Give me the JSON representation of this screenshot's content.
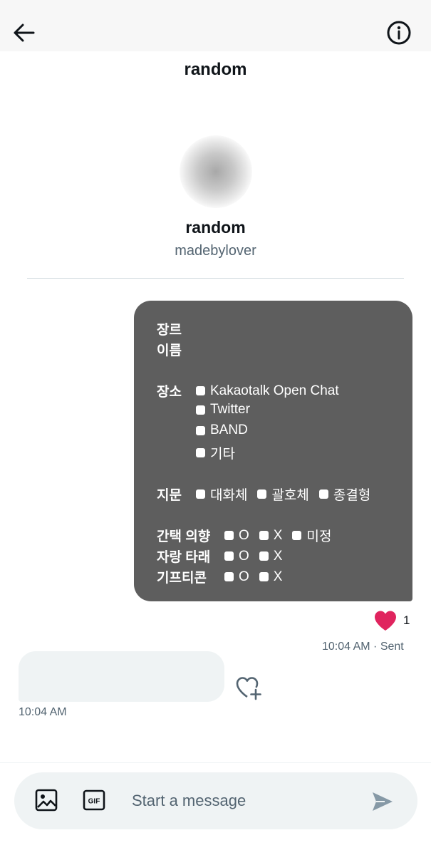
{
  "header": {
    "title": "random",
    "back_icon": "arrow-left-icon",
    "info_icon": "info-icon"
  },
  "profile": {
    "name": "random",
    "handle": "madebylover"
  },
  "outgoing_message": {
    "genre_label": "장르",
    "name_label": "이름",
    "place": {
      "label": "장소",
      "options": [
        "Kakaotalk Open Chat",
        "Twitter",
        "BAND",
        "기타"
      ]
    },
    "narration": {
      "label": "지문",
      "options": [
        "대화체",
        "괄호체",
        "종결형"
      ]
    },
    "interest": {
      "label": "간택 의향",
      "options": [
        "O",
        "X",
        "미정"
      ]
    },
    "self_promo": {
      "label": "자랑 타래",
      "options": [
        "O",
        "X"
      ]
    },
    "gifticon": {
      "label": "기프티콘",
      "options": [
        "O",
        "X"
      ]
    },
    "reaction_count": "1",
    "meta": "10:04 AM · Sent"
  },
  "incoming_message": {
    "meta": "10:04 AM"
  },
  "composer": {
    "placeholder": "Start a message",
    "gif_label": "GIF"
  },
  "colors": {
    "bubble_out": "#5e5e5e",
    "bubble_in": "#eff3f4",
    "heart": "#e0245e",
    "muted": "#536471",
    "send": "#8699a6"
  }
}
